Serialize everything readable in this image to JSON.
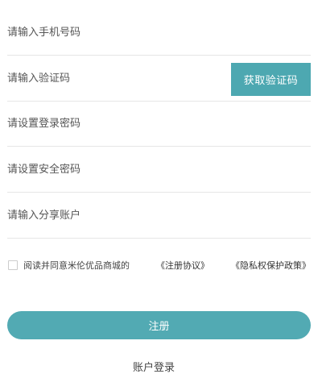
{
  "form": {
    "phone": {
      "placeholder": "请输入手机号码",
      "value": ""
    },
    "code": {
      "placeholder": "请输入验证码",
      "value": "",
      "button_label": "获取验证码"
    },
    "login_password": {
      "placeholder": "请设置登录密码",
      "value": ""
    },
    "safe_password": {
      "placeholder": "请设置安全密码",
      "value": ""
    },
    "share_account": {
      "placeholder": "请输入分享账户",
      "value": ""
    }
  },
  "agreement": {
    "checked": false,
    "text": "阅读并同意米伦优品商城的",
    "terms_link": "《注册协议》",
    "privacy_link": "《隐私权保护政策》"
  },
  "register_button": "注册",
  "account_login": "账户登录",
  "colors": {
    "accent": "#4da8b1",
    "register_button": "#52aab3",
    "divider": "#e6e6e6"
  }
}
